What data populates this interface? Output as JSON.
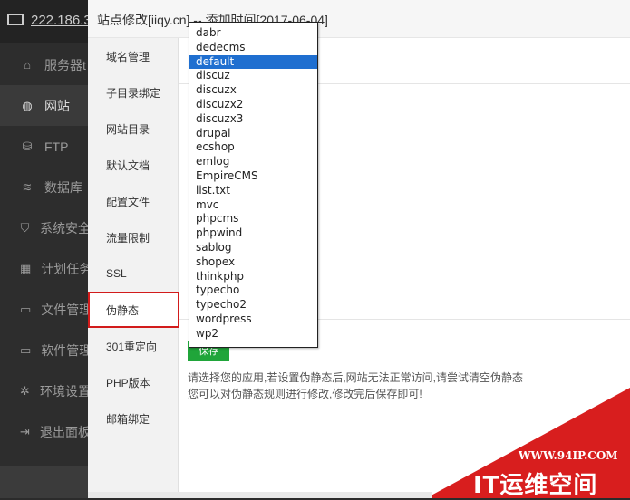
{
  "app": {
    "host_label": "222.186.3",
    "nav": [
      {
        "label": "服务器t",
        "icon": "home-icon"
      },
      {
        "label": "网站",
        "icon": "globe-icon",
        "active": true
      },
      {
        "label": "FTP",
        "icon": "ftp-icon"
      },
      {
        "label": "数据库",
        "icon": "database-icon"
      },
      {
        "label": "系统安全",
        "icon": "shield-icon"
      },
      {
        "label": "计划任务",
        "icon": "calendar-icon"
      },
      {
        "label": "文件管理",
        "icon": "folder-icon"
      },
      {
        "label": "软件管理",
        "icon": "folder-icon"
      },
      {
        "label": "环境设置",
        "icon": "gear-icon"
      },
      {
        "label": "退出面板",
        "icon": "logout-icon"
      }
    ]
  },
  "modal": {
    "title": "站点修改[iiqy.cn] -- 添加时间[2017-06-04]",
    "tabs": [
      "域名管理",
      "子目录绑定",
      "网站目录",
      "默认文档",
      "配置文件",
      "流量限制",
      "SSL",
      "伪静态",
      "301重定向",
      "PHP版本",
      "邮箱绑定"
    ],
    "selected_tab": "伪静态",
    "save_label": "保存",
    "tip_line1": "请选择您的应用,若设置伪静态后,网站无法正常访问,请尝试清空伪静态",
    "tip_line2": "您可以对伪静态规则进行修改,修改完后保存即可!"
  },
  "dropdown": {
    "options": [
      "dabr",
      "dedecms",
      "default",
      "discuz",
      "discuzx",
      "discuzx2",
      "discuzx3",
      "drupal",
      "ecshop",
      "emlog",
      "EmpireCMS",
      "list.txt",
      "mvc",
      "phpcms",
      "phpwind",
      "sablog",
      "shopex",
      "thinkphp",
      "typecho",
      "typecho2",
      "wordpress",
      "wp2"
    ],
    "selected": "default",
    "highlight_color": "#1f6fd0"
  },
  "watermark": {
    "url": "WWW.94IP.COM",
    "name": "IT运维空间"
  }
}
